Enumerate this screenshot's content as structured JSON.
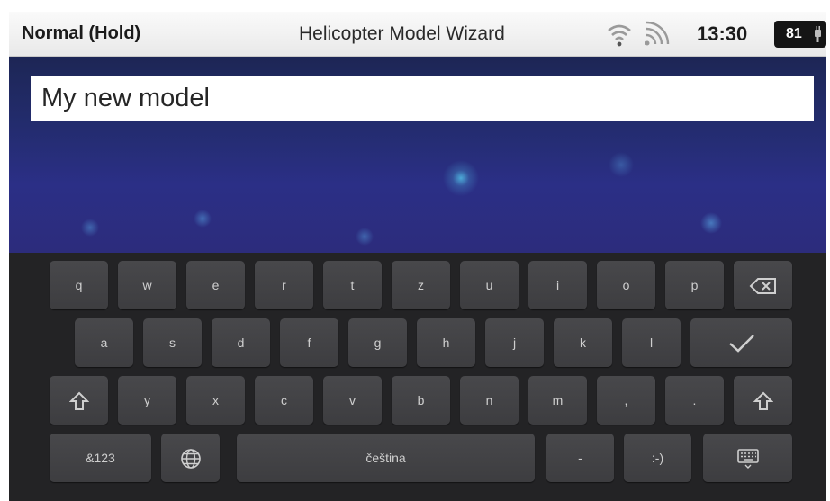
{
  "status_bar": {
    "mode": "Normal (Hold)",
    "title": "Helicopter Model Wizard",
    "time": "13:30",
    "battery": "81"
  },
  "model_name": {
    "value": "My new model"
  },
  "keyboard": {
    "row1": [
      "q",
      "w",
      "e",
      "r",
      "t",
      "z",
      "u",
      "i",
      "o",
      "p"
    ],
    "row2": [
      "a",
      "s",
      "d",
      "f",
      "g",
      "h",
      "j",
      "k",
      "l"
    ],
    "row3": [
      "y",
      "x",
      "c",
      "v",
      "b",
      "n",
      "m",
      ",",
      "."
    ],
    "symbols_label": "&123",
    "space_label": "čeština",
    "dash_label": "-",
    "smiley_label": ":-)"
  },
  "icons": [
    "wifi-icon",
    "signal-icon",
    "battery-icon",
    "backspace-icon",
    "checkmark-icon",
    "shift-icon",
    "globe-icon",
    "keyboard-hide-icon"
  ]
}
